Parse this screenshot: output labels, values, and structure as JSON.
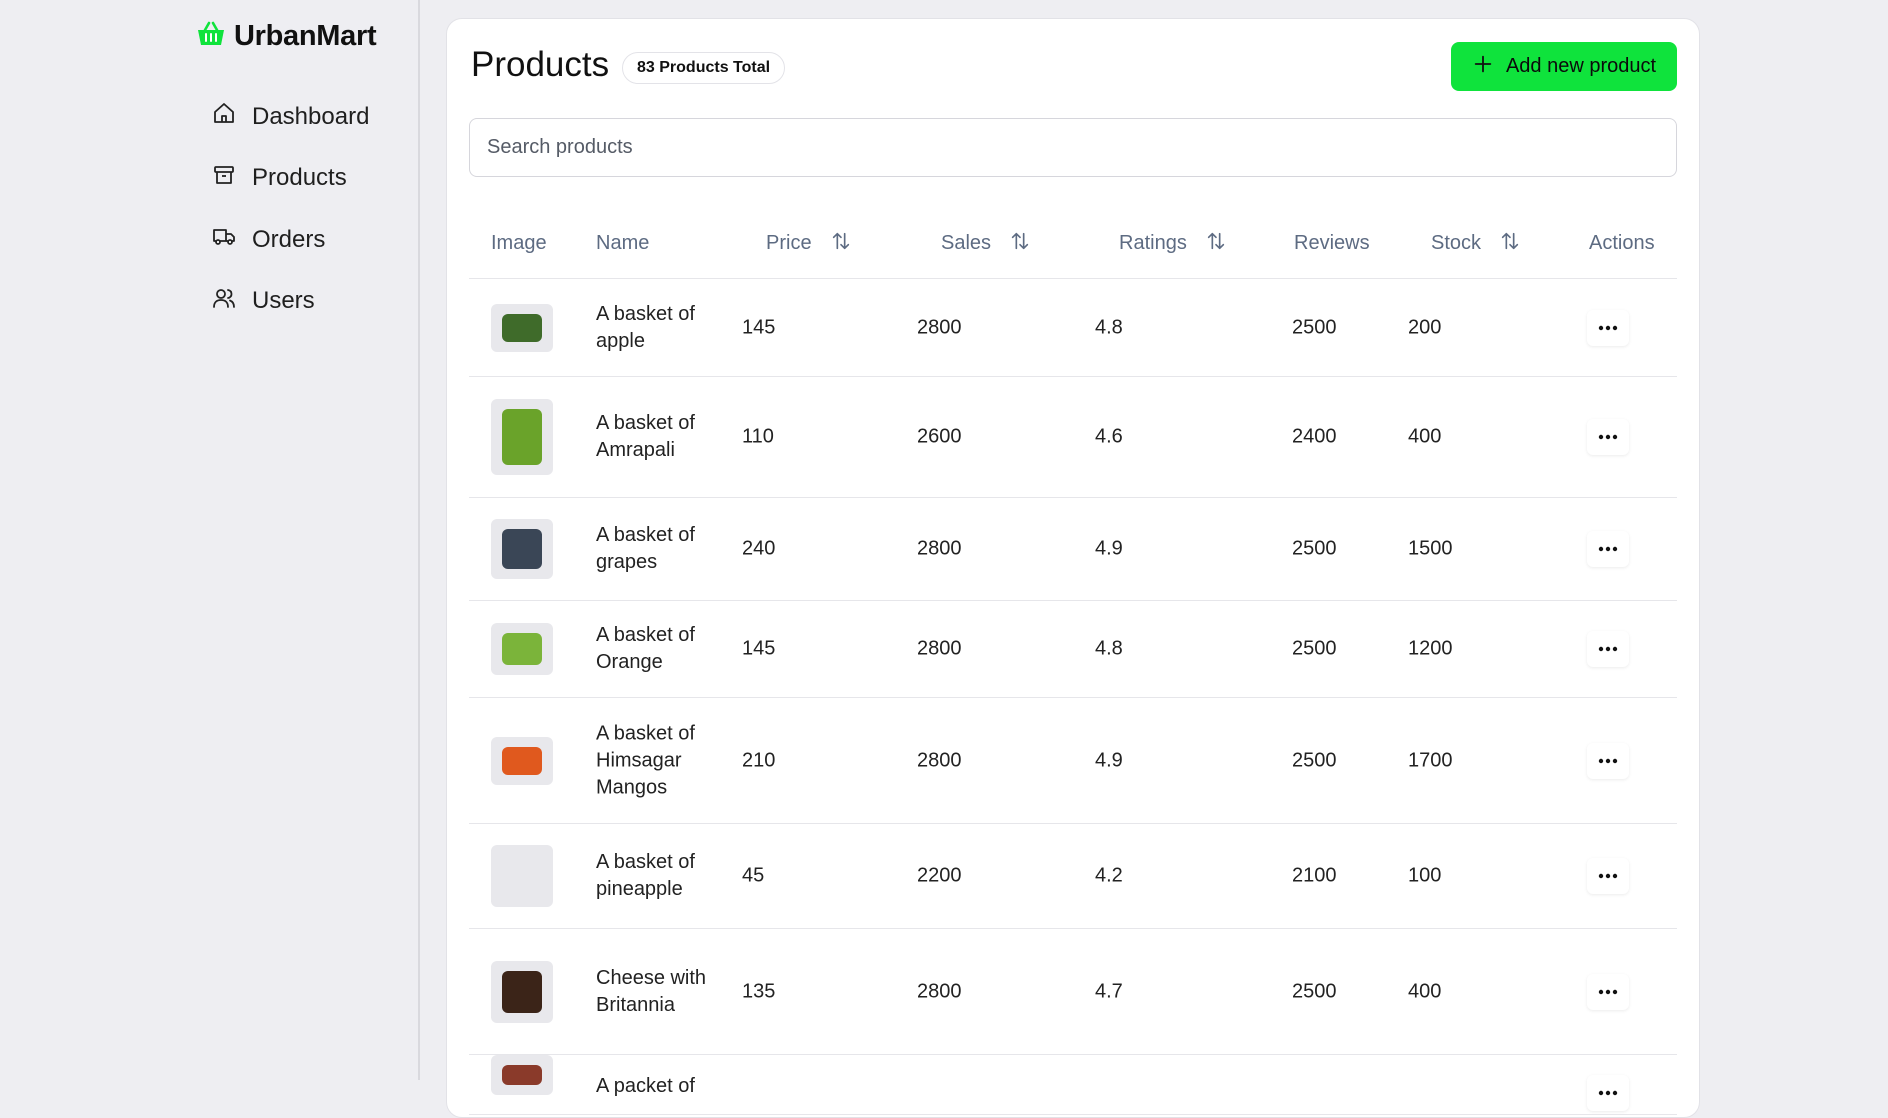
{
  "brand": {
    "name": "UrbanMart",
    "accent": "#0fe33c"
  },
  "nav": [
    {
      "label": "Dashboard",
      "icon": "home-icon"
    },
    {
      "label": "Products",
      "icon": "archive-icon"
    },
    {
      "label": "Orders",
      "icon": "truck-icon"
    },
    {
      "label": "Users",
      "icon": "users-icon"
    }
  ],
  "page": {
    "title": "Products",
    "total_badge": "83 Products Total",
    "add_button": "Add new product",
    "search_placeholder": "Search products"
  },
  "table": {
    "headers": {
      "image": "Image",
      "name": "Name",
      "price": "Price",
      "sales": "Sales",
      "ratings": "Ratings",
      "reviews": "Reviews",
      "stock": "Stock",
      "actions": "Actions"
    },
    "rows": [
      {
        "name": "A basket of apple",
        "price": "145",
        "sales": "2800",
        "ratings": "4.8",
        "reviews": "2500",
        "stock": "200",
        "thumb": "#3f6b2a"
      },
      {
        "name": "A basket of Amrapali",
        "price": "110",
        "sales": "2600",
        "ratings": "4.6",
        "reviews": "2400",
        "stock": "400",
        "thumb": "#6aa32a"
      },
      {
        "name": "A basket of grapes",
        "price": "240",
        "sales": "2800",
        "ratings": "4.9",
        "reviews": "2500",
        "stock": "1500",
        "thumb": "#3a4656"
      },
      {
        "name": "A basket of Orange",
        "price": "145",
        "sales": "2800",
        "ratings": "4.8",
        "reviews": "2500",
        "stock": "1200",
        "thumb": "#7bb43a"
      },
      {
        "name": "A basket of Himsagar Mangos",
        "price": "210",
        "sales": "2800",
        "ratings": "4.9",
        "reviews": "2500",
        "stock": "1700",
        "thumb": "#e0591e"
      },
      {
        "name": "A basket of pineapple",
        "price": "45",
        "sales": "2200",
        "ratings": "4.2",
        "reviews": "2100",
        "stock": "100",
        "thumb": ""
      },
      {
        "name": "Cheese with Britannia",
        "price": "135",
        "sales": "2800",
        "ratings": "4.7",
        "reviews": "2500",
        "stock": "400",
        "thumb": "#3b2418"
      },
      {
        "name": "A packet of",
        "price": "",
        "sales": "",
        "ratings": "",
        "reviews": "",
        "stock": "",
        "thumb": "#8a3a2a"
      }
    ]
  }
}
